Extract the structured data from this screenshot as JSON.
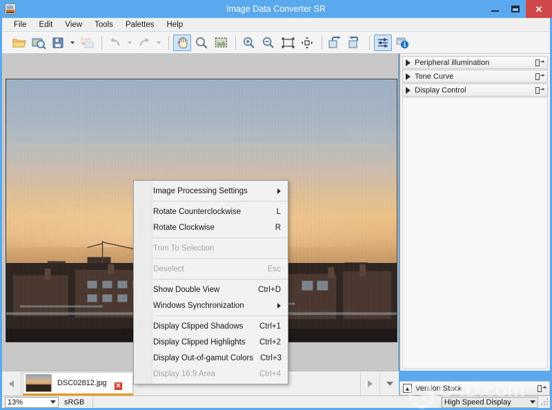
{
  "window": {
    "title": "Image Data Converter SR",
    "app_icon": "app-icon",
    "controls": {
      "minimize": "–",
      "maximize": "□",
      "close": "✕"
    }
  },
  "menubar": {
    "items": [
      {
        "label": "File"
      },
      {
        "label": "Edit"
      },
      {
        "label": "View"
      },
      {
        "label": "Tools"
      },
      {
        "label": "Palettes"
      },
      {
        "label": "Help"
      }
    ]
  },
  "toolbar": {
    "buttons": [
      {
        "name": "open-folder-icon",
        "enabled": true,
        "active": false
      },
      {
        "name": "browser-icon",
        "enabled": true,
        "active": false
      },
      {
        "name": "save-icon",
        "enabled": true,
        "active": false
      },
      {
        "name": "save-dropdown-arrow",
        "enabled": true,
        "active": false
      },
      {
        "name": "raw-convert-icon",
        "enabled": false,
        "active": false
      },
      {
        "name": "undo-icon",
        "enabled": false,
        "active": false
      },
      {
        "name": "undo-dropdown-arrow",
        "enabled": false,
        "active": false
      },
      {
        "name": "redo-icon",
        "enabled": false,
        "active": false
      },
      {
        "name": "redo-dropdown-arrow",
        "enabled": false,
        "active": false
      },
      {
        "name": "hand-tool-icon",
        "enabled": true,
        "active": true
      },
      {
        "name": "magnifier-tool-icon",
        "enabled": true,
        "active": false
      },
      {
        "name": "selection-tool-icon",
        "enabled": true,
        "active": false
      },
      {
        "name": "zoom-in-icon",
        "enabled": true,
        "active": false
      },
      {
        "name": "zoom-out-icon",
        "enabled": true,
        "active": false
      },
      {
        "name": "fit-to-window-icon",
        "enabled": true,
        "active": false
      },
      {
        "name": "actual-size-icon",
        "enabled": true,
        "active": false
      },
      {
        "name": "rotate-ccw-icon",
        "enabled": true,
        "active": false
      },
      {
        "name": "rotate-cw-icon",
        "enabled": true,
        "active": false
      },
      {
        "name": "adjustments-icon",
        "enabled": true,
        "active": true
      },
      {
        "name": "info-icon",
        "enabled": true,
        "active": false
      }
    ]
  },
  "context_menu": {
    "items": [
      {
        "label": "Image Processing Settings",
        "accel": "",
        "submenu": true,
        "disabled": false,
        "separator_after": true
      },
      {
        "label": "Rotate Counterclockwise",
        "accel": "L",
        "submenu": false,
        "disabled": false,
        "separator_after": false
      },
      {
        "label": "Rotate Clockwise",
        "accel": "R",
        "submenu": false,
        "disabled": false,
        "separator_after": true
      },
      {
        "label": "Trim To Selection",
        "accel": "",
        "submenu": false,
        "disabled": true,
        "separator_after": true
      },
      {
        "label": "Deselect",
        "accel": "Esc",
        "submenu": false,
        "disabled": true,
        "separator_after": true
      },
      {
        "label": "Show Double View",
        "accel": "Ctrl+D",
        "submenu": false,
        "disabled": false,
        "separator_after": false
      },
      {
        "label": "Windows Synchronization",
        "accel": "",
        "submenu": true,
        "disabled": false,
        "separator_after": true
      },
      {
        "label": "Display Clipped Shadows",
        "accel": "Ctrl+1",
        "submenu": false,
        "disabled": false,
        "separator_after": false
      },
      {
        "label": "Display Clipped Highlights",
        "accel": "Ctrl+2",
        "submenu": false,
        "disabled": false,
        "separator_after": false
      },
      {
        "label": "Display Out-of-gamut Colors",
        "accel": "Ctrl+3",
        "submenu": false,
        "disabled": false,
        "separator_after": false
      },
      {
        "label": "Display 16:9 Area",
        "accel": "Ctrl+4",
        "submenu": false,
        "disabled": true,
        "separator_after": false
      }
    ]
  },
  "right_panel": {
    "panels": [
      {
        "label": "Peripheral illumination",
        "expanded": false
      },
      {
        "label": "Tone Curve",
        "expanded": false
      },
      {
        "label": "Display Control",
        "expanded": false
      }
    ]
  },
  "filmstrip": {
    "prev_label": "",
    "next_label": "",
    "item": {
      "filename": "DSC02812.jpg",
      "badge": "✕",
      "selected": true
    }
  },
  "version_stack": {
    "label": "Version Stack"
  },
  "statusbar": {
    "zoom": "13%",
    "colorspace": "sRGB",
    "display_mode": "High Speed Display"
  },
  "watermark": {
    "text": "LO4D.com"
  },
  "colors": {
    "titlebar": "#5aa9ef",
    "close_button": "#cf4747",
    "accent_selected": "#e89b1c",
    "toolbar_active": "#cfe4f7"
  }
}
